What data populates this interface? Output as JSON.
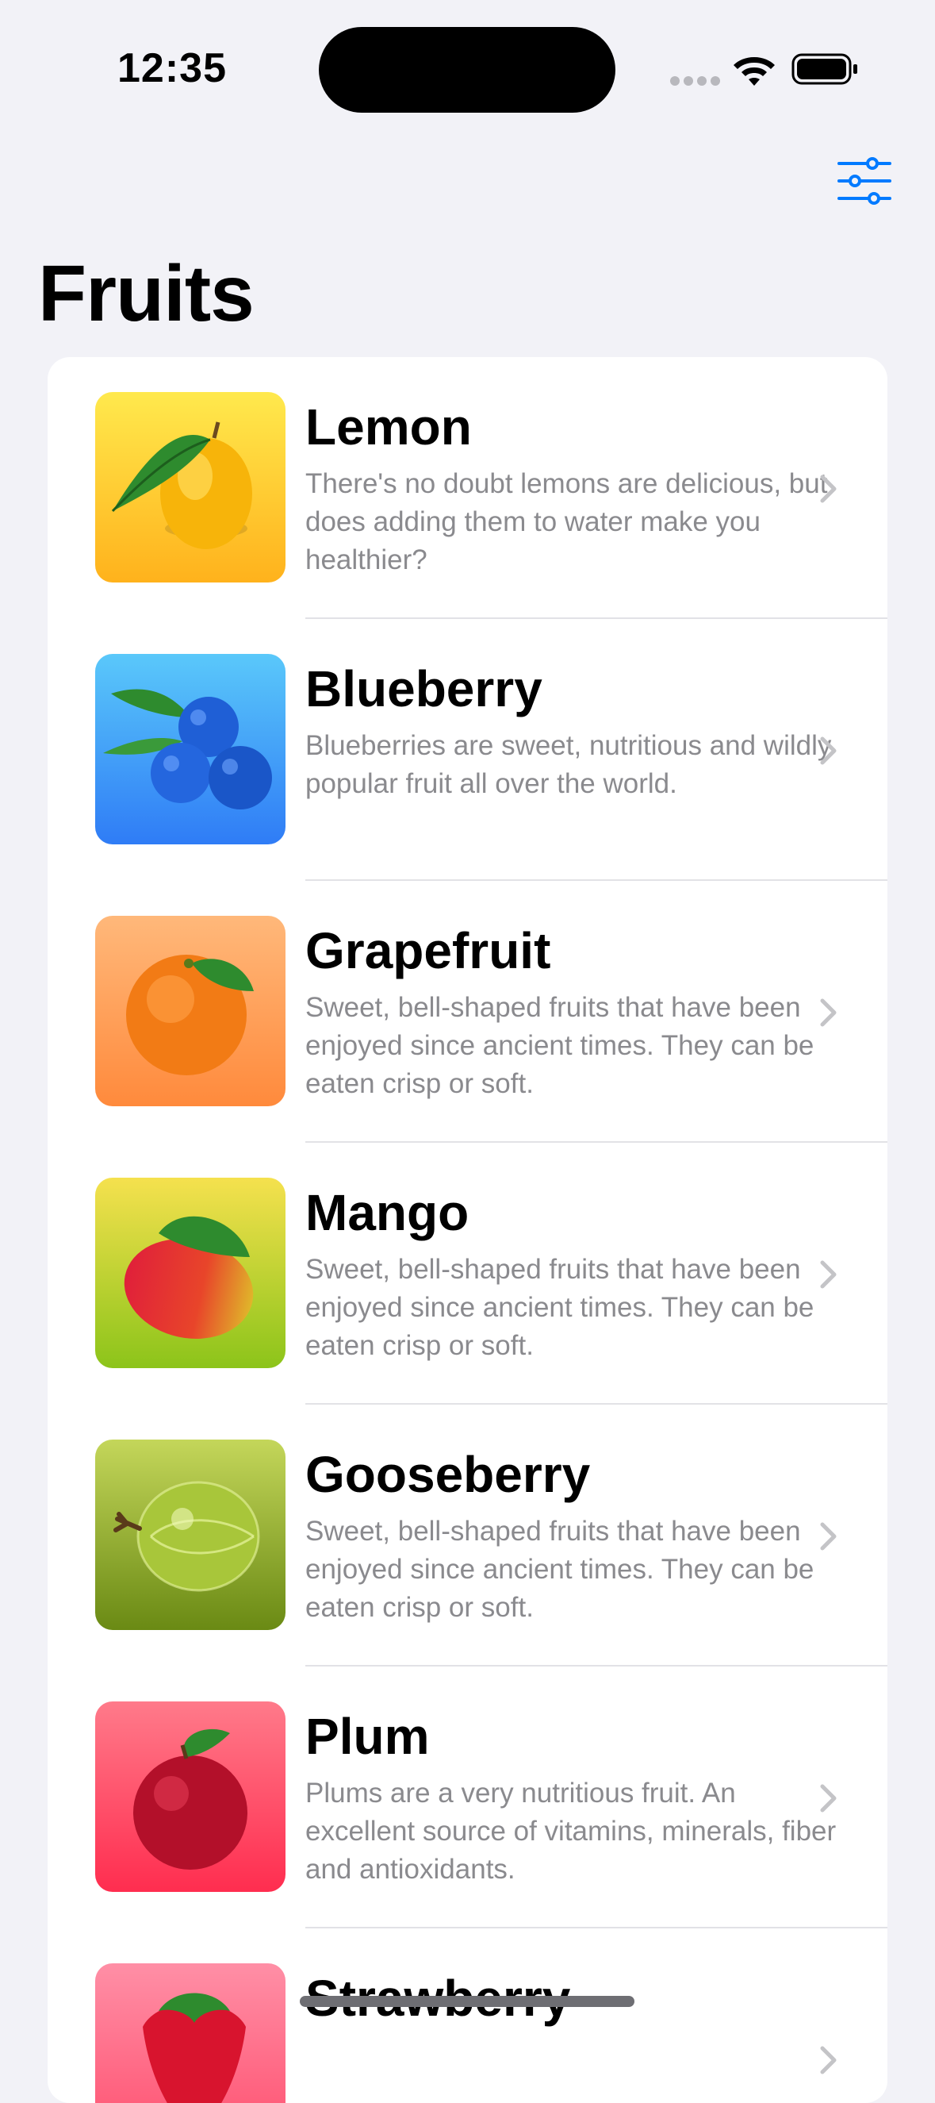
{
  "status_bar": {
    "time": "12:35",
    "icons": [
      "signal-dots-icon",
      "wifi-icon",
      "battery-icon"
    ]
  },
  "nav": {
    "title": "Fruits",
    "filter_icon": "sliders-icon",
    "accent_color": "#007aff"
  },
  "fruits": [
    {
      "name": "Lemon",
      "description": "There's no doubt lemons are delicious, but does adding them to water make you healthier?",
      "gradient": [
        "#ffe94d",
        "#ffb21c"
      ],
      "icon": "lemon-image"
    },
    {
      "name": "Blueberry",
      "description": "Blueberries are sweet, nutritious and wildly popular fruit all over the world.",
      "gradient": [
        "#5ac8fa",
        "#2f7cf6"
      ],
      "icon": "blueberry-image"
    },
    {
      "name": "Grapefruit",
      "description": "Sweet, bell-shaped fruits that have been enjoyed since ancient times. They can be eaten crisp or soft.",
      "gradient": [
        "#ffb87a",
        "#ff8a3c"
      ],
      "icon": "grapefruit-image"
    },
    {
      "name": "Mango",
      "description": "Sweet, bell-shaped fruits that have been enjoyed since ancient times. They can be eaten crisp or soft.",
      "gradient": [
        "#f5e14e",
        "#8cc41a"
      ],
      "icon": "mango-image"
    },
    {
      "name": "Gooseberry",
      "description": "Sweet, bell-shaped fruits that have been enjoyed since ancient times. They can be eaten crisp or soft.",
      "gradient": [
        "#c4d65a",
        "#6a8a14"
      ],
      "icon": "gooseberry-image"
    },
    {
      "name": "Plum",
      "description": "Plums are a very nutritious fruit. An excellent source of vitamins, minerals, fiber and antioxidants.",
      "gradient": [
        "#ff7a8a",
        "#ff2d4f"
      ],
      "icon": "plum-image"
    },
    {
      "name": "Strawberry",
      "description": "",
      "gradient": [
        "#ff8fa6",
        "#ff4d6d"
      ],
      "icon": "strawberry-image"
    }
  ]
}
